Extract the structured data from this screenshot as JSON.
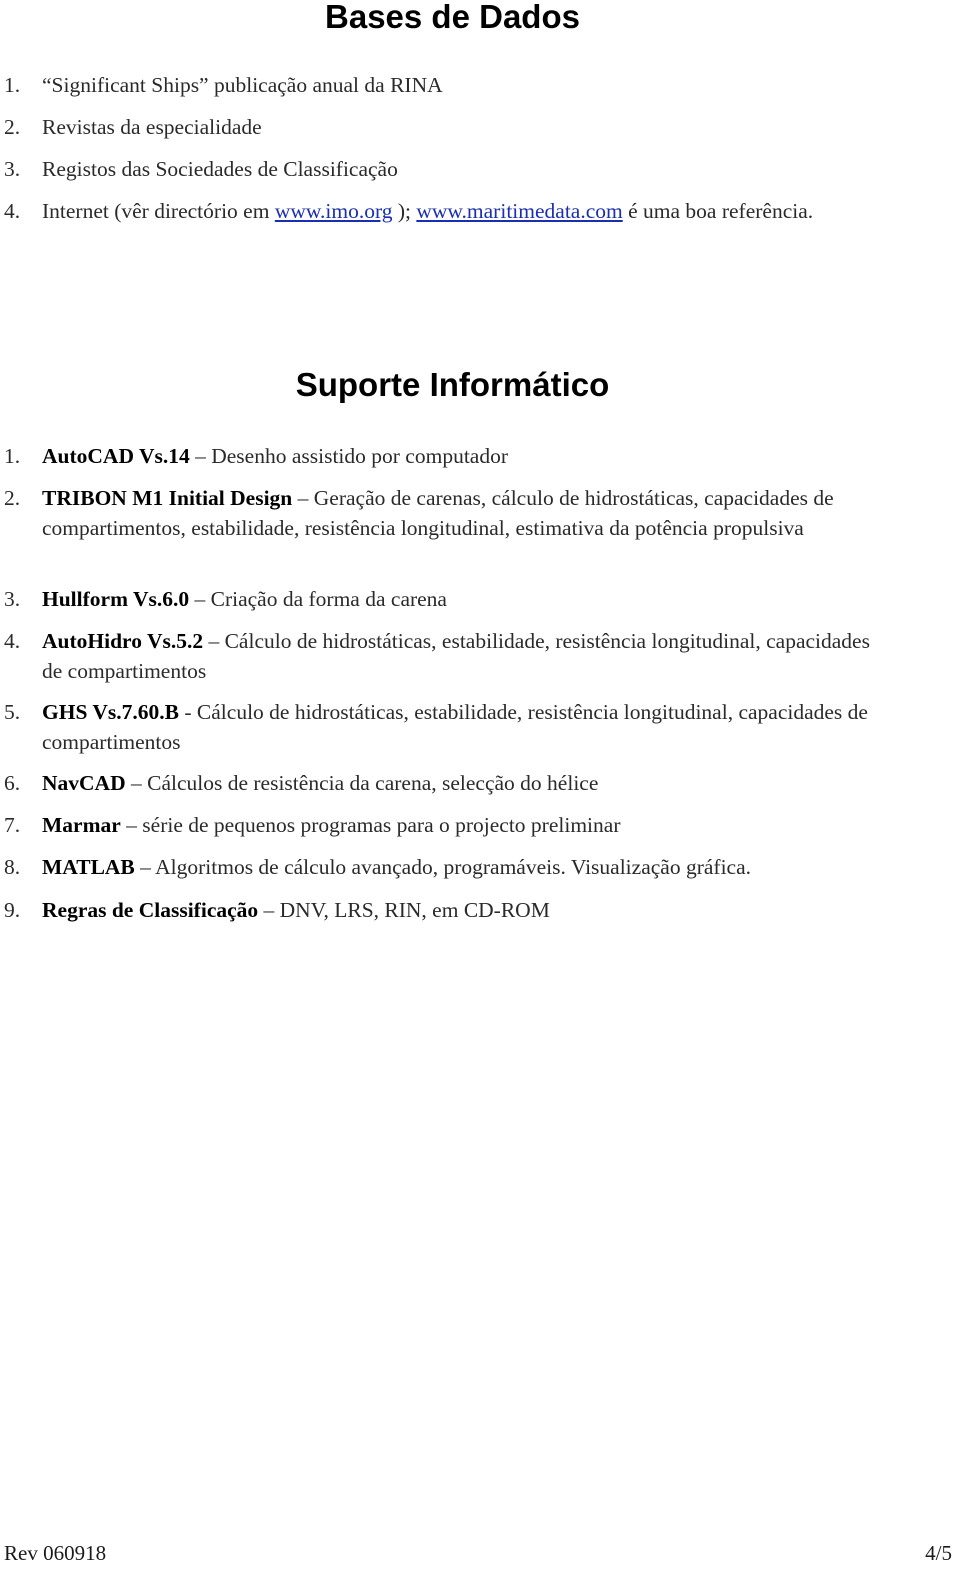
{
  "sections": {
    "bases": {
      "title": "Bases de Dados",
      "items": [
        {
          "num": "1.",
          "text": "“Significant Ships” publicação anual da RINA"
        },
        {
          "num": "2.",
          "text": "Revistas da especialidade"
        },
        {
          "num": "3.",
          "text": "Registos das Sociedades de Classificação"
        },
        {
          "num": "4.",
          "pre": "Internet (vêr directório em ",
          "link1": "www.imo.org",
          "mid": " ); ",
          "link2": "www.maritimedata.com",
          "post": " é uma boa referência."
        }
      ]
    },
    "suporte": {
      "title": "Suporte Informático",
      "items": [
        {
          "num": "1.",
          "bold": "AutoCAD Vs.14",
          "sep": " – ",
          "text": "Desenho assistido por computador"
        },
        {
          "num": "2.",
          "bold": "TRIBON M1 Initial Design",
          "sep": " – ",
          "text": "Geração de carenas, cálculo de hidrostáticas, capacidades de compartimentos, estabilidade, resistência longitudinal, estimativa da potência propulsiva"
        },
        {
          "num": "3.",
          "bold": "Hullform Vs.6.0",
          "sep": " – ",
          "text": "Criação da forma da carena"
        },
        {
          "num": "4.",
          "bold": "AutoHidro Vs.5.2",
          "sep": " – ",
          "text": "Cálculo de hidrostáticas, estabilidade, resistência longitudinal, capacidades de compartimentos"
        },
        {
          "num": "5.",
          "bold": "GHS Vs.7.60.B",
          "sep": " - ",
          "text": "Cálculo de hidrostáticas, estabilidade, resistência longitudinal, capacidades de compartimentos"
        },
        {
          "num": "6.",
          "bold": "NavCAD",
          "sep": " – ",
          "text": "Cálculos de resistência da carena, selecção do hélice"
        },
        {
          "num": "7.",
          "bold": "Marmar",
          "sep": " – ",
          "text": "série de pequenos programas para o projecto preliminar"
        },
        {
          "num": "8.",
          "bold": "MATLAB",
          "sep": " – ",
          "text": "Algoritmos de cálculo avançado, programáveis. Visualização gráfica."
        },
        {
          "num": "9.",
          "bold": "Regras de Classificação",
          "sep": " – ",
          "text": "DNV, LRS, RIN, em CD-ROM"
        }
      ]
    }
  },
  "footer": {
    "revision": "Rev 060918",
    "page": "4/5"
  }
}
